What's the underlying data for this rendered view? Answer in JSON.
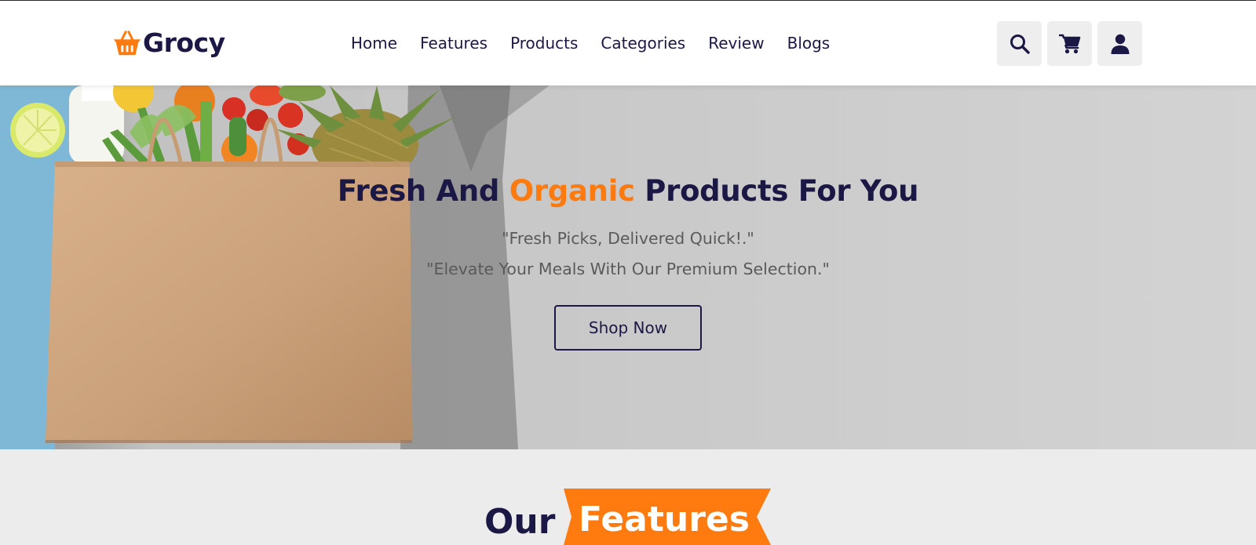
{
  "brand": {
    "name": "Grocy",
    "logo_icon": "basket-icon",
    "accent_color": "#ff7b0f",
    "primary_color": "#1b1846"
  },
  "nav": {
    "items": [
      {
        "label": "Home"
      },
      {
        "label": "Features"
      },
      {
        "label": "Products"
      },
      {
        "label": "Categories"
      },
      {
        "label": "Review"
      },
      {
        "label": "Blogs"
      }
    ]
  },
  "header_icons": [
    {
      "name": "search-icon"
    },
    {
      "name": "cart-icon"
    },
    {
      "name": "user-icon"
    }
  ],
  "hero": {
    "title_part1": "Fresh And ",
    "title_accent": "Organic",
    "title_part2": " Products For You",
    "subtitle1": "\"Fresh Picks, Delivered Quick!.\"",
    "subtitle2": "\"Elevate Your Meals With Our Premium Selection.\"",
    "cta_label": "Shop Now"
  },
  "features_section": {
    "title_plain": "Our",
    "title_ribbon": "Features"
  }
}
